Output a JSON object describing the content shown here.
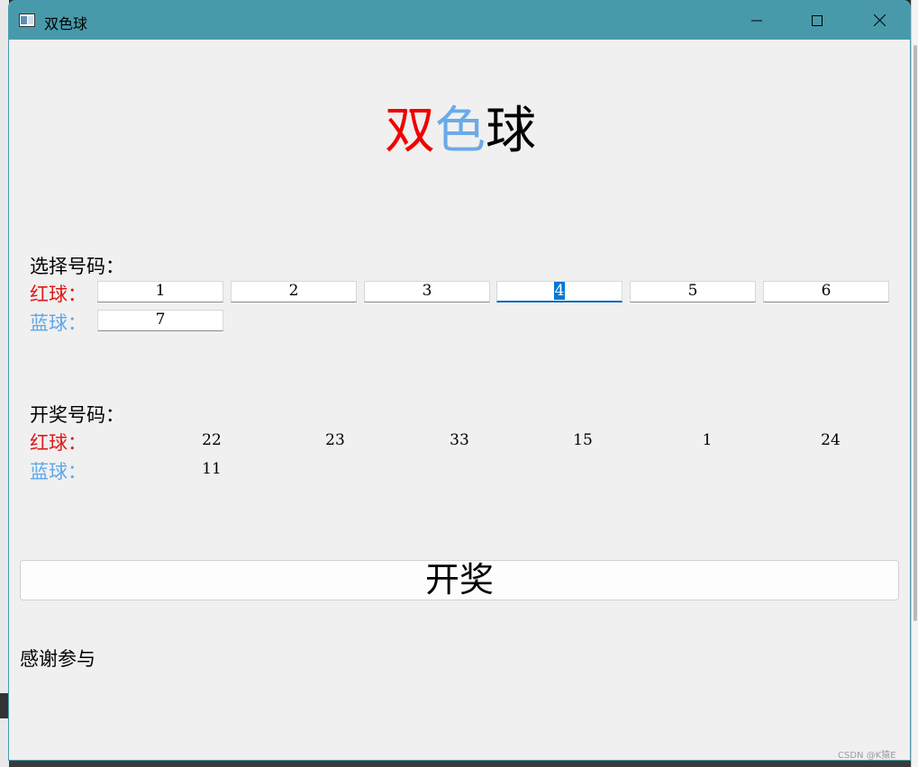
{
  "window": {
    "title": "双色球"
  },
  "header": {
    "part1": "双",
    "part2": "色",
    "part3": "球"
  },
  "select": {
    "heading": "选择号码：",
    "red_label": "红球：",
    "blue_label": "蓝球：",
    "red_values": [
      "1",
      "2",
      "3",
      "4",
      "5",
      "6"
    ],
    "blue_values": [
      "7"
    ]
  },
  "draw": {
    "heading": "开奖号码：",
    "red_label": "红球：",
    "blue_label": "蓝球：",
    "red_values": [
      "22",
      "23",
      "33",
      "15",
      "1",
      "24"
    ],
    "blue_values": [
      "11"
    ]
  },
  "button": {
    "label": "开奖"
  },
  "result": {
    "text": "感谢参与"
  },
  "watermark": "CSDN @K猿E",
  "colors": {
    "titlebar": "#489aab",
    "red": "#e01818",
    "blue": "#5fa8e8",
    "selection": "#0078d7"
  }
}
